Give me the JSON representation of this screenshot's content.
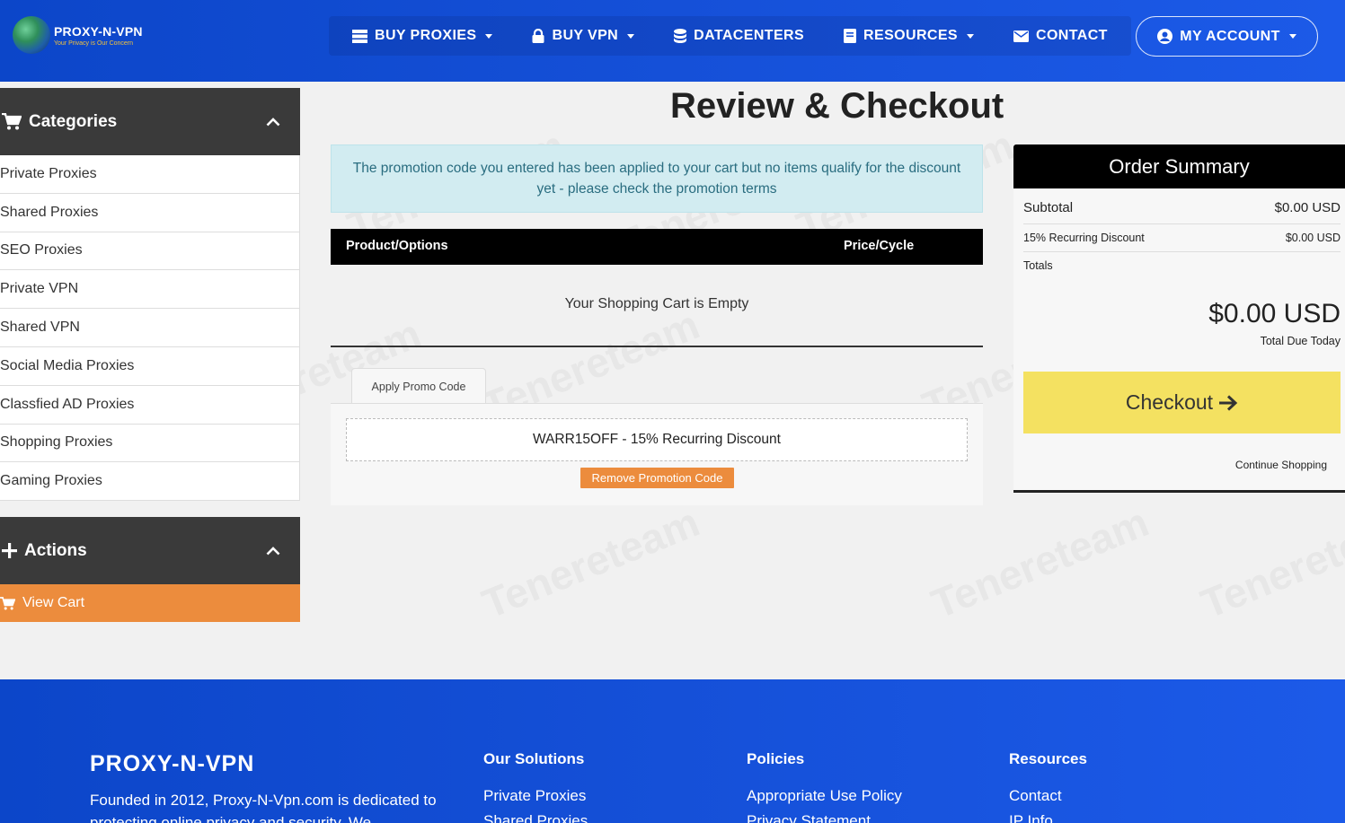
{
  "brand": {
    "name": "PROXY-N-VPN",
    "tagline": "Your Privacy is Our Concern"
  },
  "nav": {
    "items": [
      {
        "label": "BUY PROXIES",
        "icon": "server-icon",
        "dropdown": true
      },
      {
        "label": "BUY VPN",
        "icon": "lock-icon",
        "dropdown": true
      },
      {
        "label": "DATACENTERS",
        "icon": "database-icon",
        "dropdown": false
      },
      {
        "label": "RESOURCES",
        "icon": "book-icon",
        "dropdown": true
      },
      {
        "label": "CONTACT",
        "icon": "envelope-icon",
        "dropdown": false
      }
    ],
    "account_label": "MY ACCOUNT"
  },
  "sidebar": {
    "categories_title": "Categories",
    "categories": [
      "Private Proxies",
      "Shared Proxies",
      "SEO Proxies",
      "Private VPN",
      "Shared VPN",
      "Social Media Proxies",
      "Classfied AD Proxies",
      "Shopping Proxies",
      "Gaming Proxies"
    ],
    "actions_title": "Actions",
    "view_cart_label": "View Cart"
  },
  "main": {
    "title": "Review & Checkout",
    "alert_text": "The promotion code you entered has been applied to your cart but no items qualify for the discount yet - please check the promotion terms",
    "cart_headers": {
      "product": "Product/Options",
      "price": "Price/Cycle"
    },
    "cart_empty_text": "Your Shopping Cart is Empty",
    "promo_tab_label": "Apply Promo Code",
    "promo_code_text": "WARR15OFF - 15% Recurring Discount",
    "remove_promo_label": "Remove Promotion Code"
  },
  "summary": {
    "title": "Order Summary",
    "subtotal_label": "Subtotal",
    "subtotal_value": "$0.00 USD",
    "discount_label": "15% Recurring Discount",
    "discount_value": "$0.00 USD",
    "totals_label": "Totals",
    "total_amount": "$0.00 USD",
    "total_caption": "Total Due Today",
    "checkout_label": "Checkout",
    "continue_label": "Continue Shopping"
  },
  "footer": {
    "brand": "PROXY-N-VPN",
    "about": "Founded in 2012, Proxy-N-Vpn.com is dedicated to protecting online privacy and security. We",
    "columns": [
      {
        "title": "Our Solutions",
        "links": [
          "Private Proxies",
          "Shared Proxies"
        ]
      },
      {
        "title": "Policies",
        "links": [
          "Appropriate Use Policy",
          "Privacy Statement"
        ]
      },
      {
        "title": "Resources",
        "links": [
          "Contact",
          "IP Info"
        ]
      }
    ]
  },
  "colors": {
    "header_blue": "#1550d8",
    "orange": "#ec8c3d",
    "checkout_yellow": "#f4e161",
    "alert_bg": "#d2ecf1",
    "dark_panel": "#3a3a3a"
  }
}
